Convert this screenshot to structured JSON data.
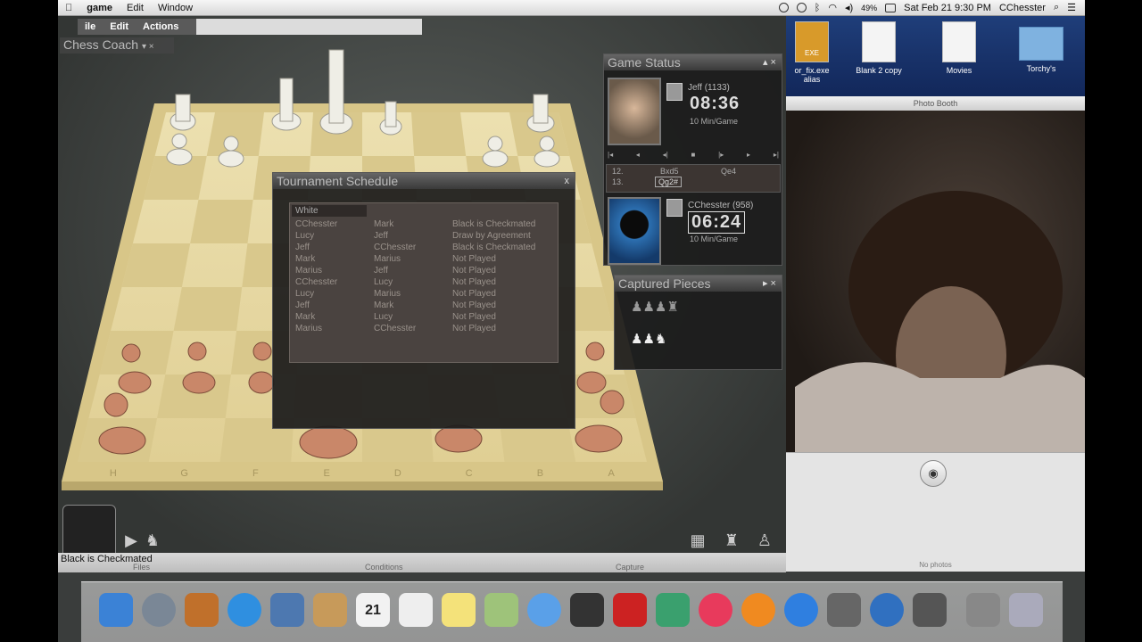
{
  "menubar": {
    "apple": "",
    "app": "game",
    "items": [
      "Edit",
      "Window"
    ],
    "battery": "49%",
    "clock": "Sat Feb 21  9:30 PM",
    "user": "CChesster"
  },
  "appmenu": {
    "items": [
      "ile",
      "Edit",
      "Actions"
    ]
  },
  "coach": {
    "title": "Chess Coach"
  },
  "tournament": {
    "title": "Tournament Schedule",
    "close": "x",
    "header": "White",
    "rows": [
      {
        "white": "CChesster",
        "black": "Mark",
        "result": "Black is Checkmated"
      },
      {
        "white": "Lucy",
        "black": "Jeff",
        "result": "Draw by Agreement"
      },
      {
        "white": "Jeff",
        "black": "CChesster",
        "result": "Black is Checkmated"
      },
      {
        "white": "Mark",
        "black": "Marius",
        "result": "Not Played"
      },
      {
        "white": "Marius",
        "black": "Jeff",
        "result": "Not Played"
      },
      {
        "white": "CChesster",
        "black": "Lucy",
        "result": "Not Played"
      },
      {
        "white": "Lucy",
        "black": "Marius",
        "result": "Not Played"
      },
      {
        "white": "Jeff",
        "black": "Mark",
        "result": "Not Played"
      },
      {
        "white": "Mark",
        "black": "Lucy",
        "result": "Not Played"
      },
      {
        "white": "Marius",
        "black": "CChesster",
        "result": "Not Played"
      }
    ]
  },
  "game_status": {
    "title": "Game Status",
    "player1": {
      "name": "Jeff (1133)",
      "clock": "08:36",
      "time_control": "10 Min/Game"
    },
    "player2": {
      "name": "CChesster (958)",
      "clock": "06:24",
      "time_control": "10 Min/Game"
    },
    "moves": [
      {
        "num": "12.",
        "white": "Bxd5",
        "black": "Qe4"
      },
      {
        "num": "13.",
        "white": "Qg2#",
        "black": ""
      }
    ]
  },
  "captured": {
    "title": "Captured Pieces",
    "row1": "♟♟♟♜",
    "row2": "♟♟♞"
  },
  "status_strip": {
    "text": "Black is Checkmated",
    "labels": [
      "Files",
      "Conditions",
      "Capture"
    ]
  },
  "photobooth": {
    "title": "Photo Booth",
    "no_photos": "No photos"
  },
  "desktop": {
    "icons": [
      "or_fix.exe\nalias",
      "Blank 2 copy",
      "Movies",
      "Torchy's"
    ],
    "exe_label": "EXE"
  },
  "board": {
    "file_labels": [
      "H",
      "G",
      "F",
      "E",
      "D",
      "C",
      "B",
      "A"
    ]
  }
}
